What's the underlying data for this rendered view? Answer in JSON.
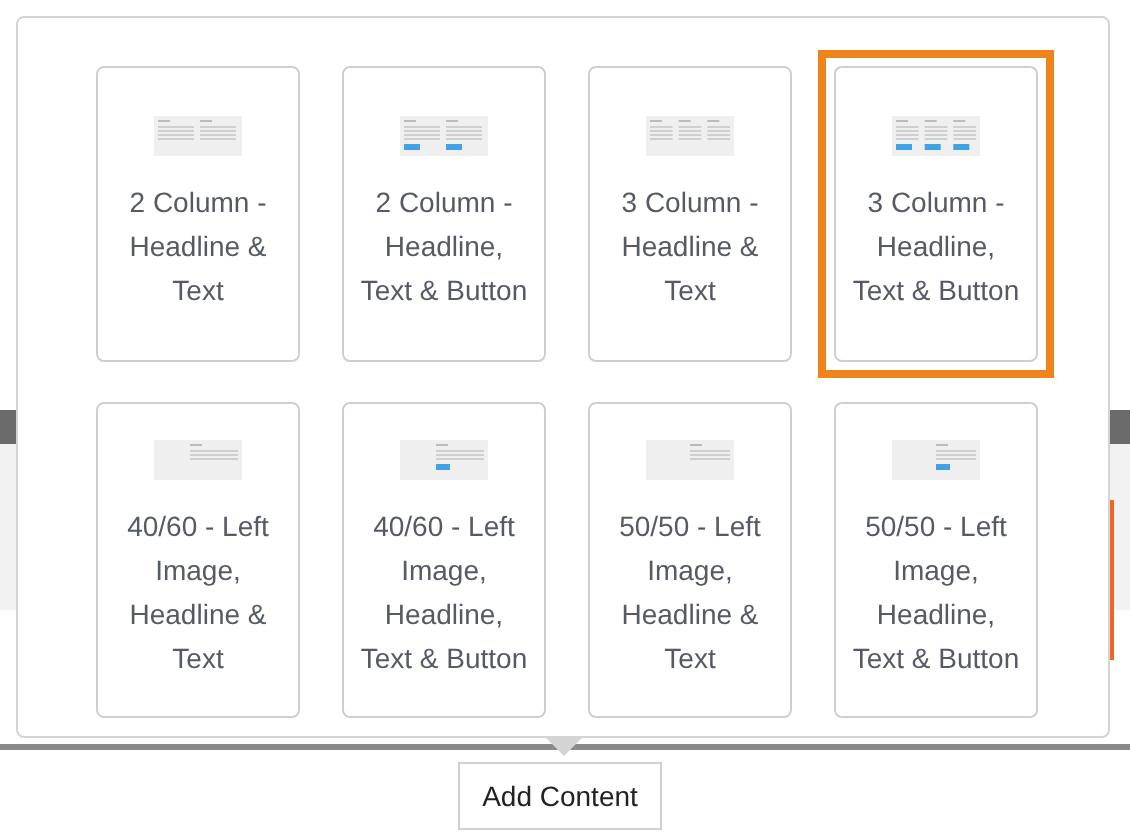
{
  "popup": {
    "templates": [
      {
        "label": "2 Column - Headline & Text",
        "kind": "two-col",
        "selected": false
      },
      {
        "label": "2 Column - Headline, Text & Button",
        "kind": "two-col-button",
        "selected": false
      },
      {
        "label": "3 Column - Headline & Text",
        "kind": "three-col",
        "selected": false
      },
      {
        "label": "3 Column - Headline, Text & Button",
        "kind": "three-col-button",
        "selected": true
      },
      {
        "label": "40/60 - Left Image, Headline & Text",
        "kind": "left-image",
        "selected": false
      },
      {
        "label": "40/60 - Left Image, Headline, Text & Button",
        "kind": "left-image-button",
        "selected": false
      },
      {
        "label": "50/50 - Left Image, Headline & Text",
        "kind": "half-image",
        "selected": false
      },
      {
        "label": "50/50 - Left Image, Headline, Text & Button",
        "kind": "half-image-button",
        "selected": false
      }
    ]
  },
  "add_button": {
    "label": "Add Content"
  }
}
